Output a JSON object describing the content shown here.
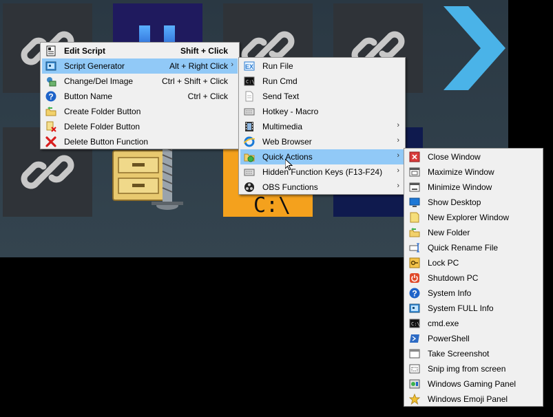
{
  "deck": {
    "cmd_tile_text": "C:\\"
  },
  "menu1": {
    "items": [
      {
        "label": "Edit Script",
        "shortcut": "Shift + Click",
        "icon": "script-edit-icon"
      },
      {
        "label": "Script Generator",
        "shortcut": "Alt + Right Click",
        "icon": "generator-icon"
      },
      {
        "label": "Change/Del Image",
        "shortcut": "Ctrl + Shift + Click",
        "icon": "image-icon"
      },
      {
        "label": "Button Name",
        "shortcut": "Ctrl + Click",
        "icon": "help-icon"
      },
      {
        "label": "Create Folder Button",
        "shortcut": "",
        "icon": "folder-add-icon"
      },
      {
        "label": "Delete Folder Button",
        "shortcut": "",
        "icon": "folder-delete-icon"
      },
      {
        "label": "Delete Button Function",
        "shortcut": "",
        "icon": "delete-x-icon"
      }
    ]
  },
  "menu2": {
    "items": [
      {
        "label": "Run File",
        "icon": "run-file-icon"
      },
      {
        "label": "Run Cmd",
        "icon": "cmd-icon"
      },
      {
        "label": "Send Text",
        "icon": "text-file-icon"
      },
      {
        "label": "Hotkey - Macro",
        "icon": "keyboard-icon"
      },
      {
        "label": "Multimedia",
        "icon": "film-icon"
      },
      {
        "label": "Web Browser",
        "icon": "ie-icon"
      },
      {
        "label": "Quick Actions",
        "icon": "quick-actions-icon"
      },
      {
        "label": "Hidden Function Keys (F13-F24)",
        "icon": "keyboard-icon"
      },
      {
        "label": "OBS Functions",
        "icon": "obs-icon"
      }
    ]
  },
  "menu3": {
    "items": [
      {
        "label": "Close Window",
        "icon": "close-window-icon"
      },
      {
        "label": "Maximize Window",
        "icon": "maximize-icon"
      },
      {
        "label": "Minimize Window",
        "icon": "minimize-icon"
      },
      {
        "label": "Show Desktop",
        "icon": "desktop-icon"
      },
      {
        "label": "New Explorer Window",
        "icon": "explorer-icon"
      },
      {
        "label": "New Folder",
        "icon": "new-folder-icon"
      },
      {
        "label": "Quick Rename File",
        "icon": "rename-icon"
      },
      {
        "label": "Lock PC",
        "icon": "lock-icon"
      },
      {
        "label": "Shutdown PC",
        "icon": "power-icon"
      },
      {
        "label": "System Info",
        "icon": "help-icon"
      },
      {
        "label": "System FULL Info",
        "icon": "system-info-icon"
      },
      {
        "label": "cmd.exe",
        "icon": "cmd-icon"
      },
      {
        "label": "PowerShell",
        "icon": "powershell-icon"
      },
      {
        "label": "Take Screenshot",
        "icon": "screenshot-icon"
      },
      {
        "label": "Snip img from screen",
        "icon": "snip-icon"
      },
      {
        "label": "Windows Gaming Panel",
        "icon": "gaming-icon"
      },
      {
        "label": "Windows Emoji Panel",
        "icon": "star-icon"
      }
    ]
  },
  "colors": {
    "highlight": "#91c9f7",
    "menu_bg": "#f0f0f0",
    "arrow_blue": "#4ab3e8",
    "cmd_tile": "#f4a11d"
  }
}
